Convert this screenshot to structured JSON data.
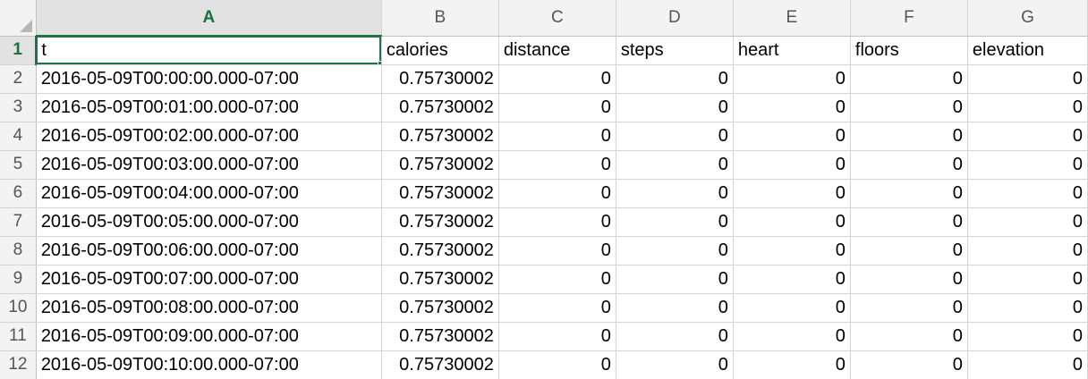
{
  "column_letters": [
    "A",
    "B",
    "C",
    "D",
    "E",
    "F",
    "G"
  ],
  "active_column": "A",
  "active_row": 1,
  "header_row": {
    "number": 1,
    "cells": [
      "t",
      "calories",
      "distance",
      "steps",
      "heart",
      "floors",
      "elevation"
    ]
  },
  "rows": [
    {
      "number": 2,
      "cells": [
        "2016-05-09T00:00:00.000-07:00",
        "0.75730002",
        "0",
        "0",
        "0",
        "0",
        "0"
      ]
    },
    {
      "number": 3,
      "cells": [
        "2016-05-09T00:01:00.000-07:00",
        "0.75730002",
        "0",
        "0",
        "0",
        "0",
        "0"
      ]
    },
    {
      "number": 4,
      "cells": [
        "2016-05-09T00:02:00.000-07:00",
        "0.75730002",
        "0",
        "0",
        "0",
        "0",
        "0"
      ]
    },
    {
      "number": 5,
      "cells": [
        "2016-05-09T00:03:00.000-07:00",
        "0.75730002",
        "0",
        "0",
        "0",
        "0",
        "0"
      ]
    },
    {
      "number": 6,
      "cells": [
        "2016-05-09T00:04:00.000-07:00",
        "0.75730002",
        "0",
        "0",
        "0",
        "0",
        "0"
      ]
    },
    {
      "number": 7,
      "cells": [
        "2016-05-09T00:05:00.000-07:00",
        "0.75730002",
        "0",
        "0",
        "0",
        "0",
        "0"
      ]
    },
    {
      "number": 8,
      "cells": [
        "2016-05-09T00:06:00.000-07:00",
        "0.75730002",
        "0",
        "0",
        "0",
        "0",
        "0"
      ]
    },
    {
      "number": 9,
      "cells": [
        "2016-05-09T00:07:00.000-07:00",
        "0.75730002",
        "0",
        "0",
        "0",
        "0",
        "0"
      ]
    },
    {
      "number": 10,
      "cells": [
        "2016-05-09T00:08:00.000-07:00",
        "0.75730002",
        "0",
        "0",
        "0",
        "0",
        "0"
      ]
    },
    {
      "number": 11,
      "cells": [
        "2016-05-09T00:09:00.000-07:00",
        "0.75730002",
        "0",
        "0",
        "0",
        "0",
        "0"
      ]
    },
    {
      "number": 12,
      "cells": [
        "2016-05-09T00:10:00.000-07:00",
        "0.75730002",
        "0",
        "0",
        "0",
        "0",
        "0"
      ]
    }
  ],
  "colors": {
    "selection_accent": "#217346",
    "header_background": "#f3f3f3",
    "gridline": "#d4d4d4"
  }
}
